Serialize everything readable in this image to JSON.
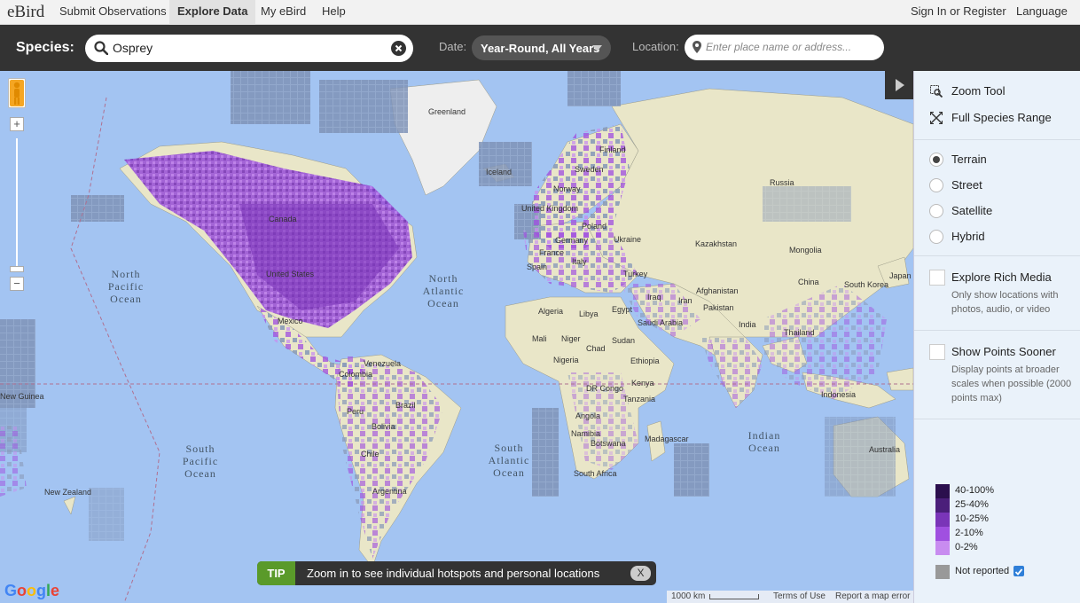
{
  "nav": {
    "logo_text": "eBird",
    "items": [
      "Submit Observations",
      "Explore Data",
      "My eBird",
      "Help"
    ],
    "sign_in": "Sign In or Register",
    "language": "Language"
  },
  "search": {
    "species_label": "Species:",
    "species_value": "Osprey",
    "date_label": "Date:",
    "date_value": "Year-Round, All Years",
    "location_label": "Location:",
    "location_placeholder": "Enter place name or address..."
  },
  "map": {
    "ocean_labels": {
      "north_pacific": [
        "North",
        "Pacific",
        "Ocean"
      ],
      "north_atlantic": [
        "North",
        "Atlantic",
        "Ocean"
      ],
      "south_pacific": [
        "South",
        "Pacific",
        "Ocean"
      ],
      "south_atlantic": [
        "South",
        "Atlantic",
        "Ocean"
      ],
      "indian": [
        "Indian",
        "Ocean"
      ]
    },
    "place_labels": [
      "Greenland",
      "Iceland",
      "Finland",
      "Sweden",
      "Norway",
      "United Kingdom",
      "Poland",
      "Germany",
      "France",
      "Spain",
      "Italy",
      "Ukraine",
      "Russia",
      "Kazakhstan",
      "Mongolia",
      "China",
      "South Korea",
      "Japan",
      "Turkey",
      "Iraq",
      "Iran",
      "Afghanistan",
      "Pakistan",
      "India",
      "Thailand",
      "Indonesia",
      "Australia",
      "Canada",
      "United States",
      "Mexico",
      "Venezuela",
      "Colombia",
      "Peru",
      "Brazil",
      "Bolivia",
      "Chile",
      "Argentina",
      "Algeria",
      "Libya",
      "Egypt",
      "Mali",
      "Niger",
      "Chad",
      "Sudan",
      "Nigeria",
      "Ethiopia",
      "DR Congo",
      "Kenya",
      "Tanzania",
      "Angola",
      "Namibia",
      "Botswana",
      "Madagascar",
      "South Africa",
      "Saudi Arabia",
      "New Zealand",
      "New Guinea"
    ],
    "scale": "1000 km",
    "terms": "Terms of Use",
    "report": "Report a map error",
    "google": "Google"
  },
  "tip": {
    "badge": "TIP",
    "message": "Zoom in to see individual hotspots and personal locations",
    "close": "X"
  },
  "sidebar": {
    "tools": [
      "Zoom Tool",
      "Full Species Range"
    ],
    "map_types": [
      "Terrain",
      "Street",
      "Satellite",
      "Hybrid"
    ],
    "selected_map_type": "Terrain",
    "rich_media": {
      "label": "Explore Rich Media",
      "desc": "Only show locations with photos, audio, or video",
      "checked": false
    },
    "points_sooner": {
      "label": "Show Points Sooner",
      "desc": "Display points at broader scales when possible (2000 points max)",
      "checked": false
    },
    "legend": [
      {
        "label": "40-100%",
        "color": "#2b0f4d"
      },
      {
        "label": "25-40%",
        "color": "#4b1f7a"
      },
      {
        "label": "10-25%",
        "color": "#7a35b8"
      },
      {
        "label": "2-10%",
        "color": "#a050e0"
      },
      {
        "label": "0-2%",
        "color": "#c88cf0"
      }
    ],
    "not_reported": {
      "label": "Not reported",
      "color": "#999999",
      "checked": true
    }
  }
}
